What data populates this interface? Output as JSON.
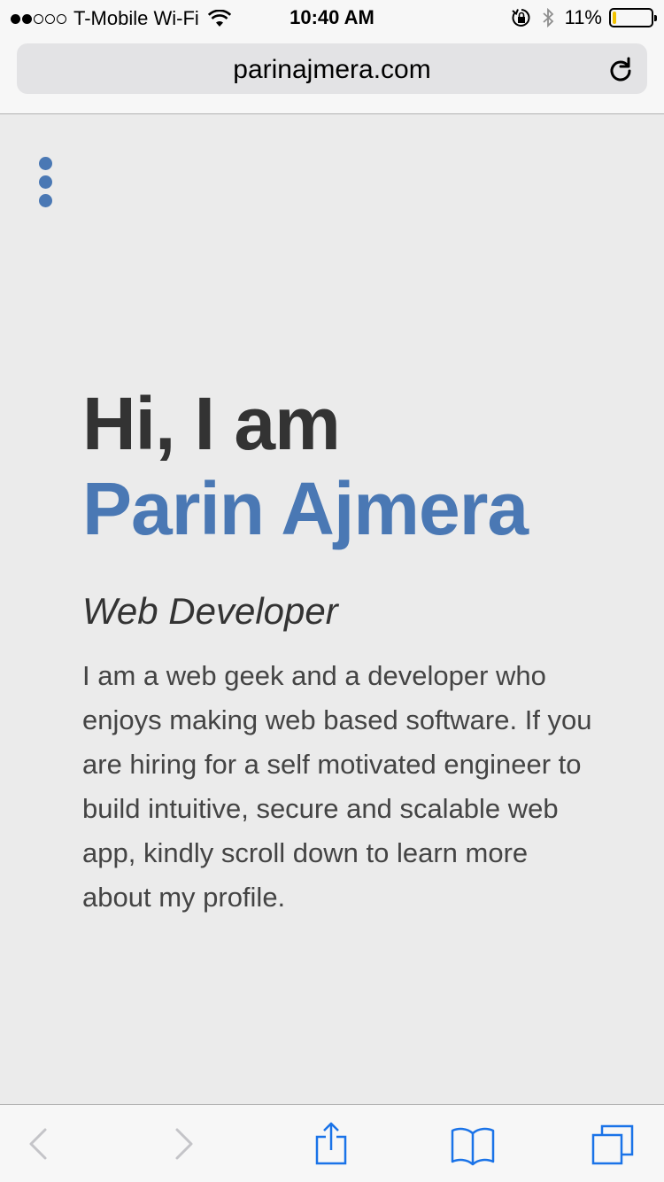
{
  "status_bar": {
    "carrier": "T-Mobile Wi-Fi",
    "time": "10:40 AM",
    "battery_percent": "11%",
    "battery_level": 0.11,
    "signal_bars_filled": 2,
    "signal_bars_total": 5
  },
  "browser": {
    "url": "parinajmera.com",
    "reload_icon": "reload-icon"
  },
  "page": {
    "menu_icon": "vertical-dots-icon",
    "greeting": "Hi, I am",
    "name": "Parin Ajmera",
    "role": "Web Developer",
    "bio": "I am a web geek and a developer who enjoys making web based software. If you are hiring for a self motivated engineer to build intuitive, secure and scalable web app, kindly scroll down to learn more about my profile.",
    "accent_color": "#4a78b4",
    "text_color": "#333333",
    "background_color": "#ebebeb"
  },
  "toolbar": {
    "items": [
      "back-icon",
      "forward-icon",
      "share-icon",
      "bookmarks-icon",
      "tabs-icon"
    ],
    "accent_color": "#1a73e8"
  }
}
